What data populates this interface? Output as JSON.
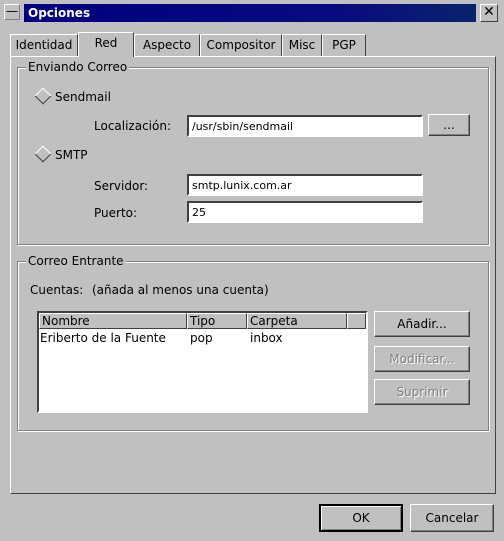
{
  "window": {
    "title": "Opciones",
    "menu_glyph": "—",
    "close_glyph": "✕"
  },
  "tabs": [
    {
      "label": "Identidad"
    },
    {
      "label": "Red"
    },
    {
      "label": "Aspecto"
    },
    {
      "label": "Compositor"
    },
    {
      "label": "Misc"
    },
    {
      "label": "PGP"
    }
  ],
  "active_tab": "Red",
  "sending": {
    "group_label": "Enviando Correo",
    "sendmail_label": "Sendmail",
    "location_label": "Localización:",
    "location_value": "/usr/sbin/sendmail",
    "browse_label": "...",
    "smtp_label": "SMTP",
    "server_label": "Servidor:",
    "server_value": "smtp.lunix.com.ar",
    "port_label": "Puerto:",
    "port_value": "25"
  },
  "incoming": {
    "group_label": "Correo Entrante",
    "accounts_label": "Cuentas:",
    "accounts_hint": "(añada al menos una cuenta)",
    "columns": [
      "Nombre",
      "Tipo",
      "Carpeta"
    ],
    "rows": [
      {
        "name": "Eriberto de la Fuente",
        "type": "pop",
        "folder": "inbox"
      }
    ],
    "add_label": "Añadir...",
    "modify_label": "Modificar...",
    "delete_label": "Suprimir"
  },
  "footer": {
    "ok_label": "OK",
    "cancel_label": "Cancelar"
  }
}
